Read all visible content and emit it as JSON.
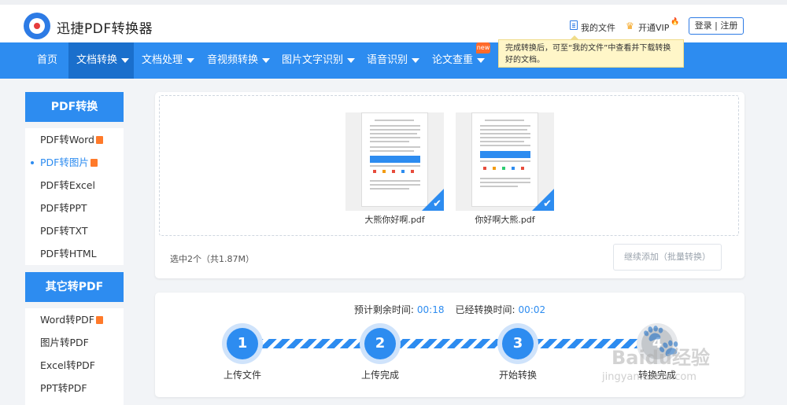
{
  "header": {
    "brand": "迅捷PDF转换器",
    "my_files": "我的文件",
    "vip": "开通VIP",
    "login": "登录 | 注册"
  },
  "nav": {
    "items": [
      {
        "label": "首页",
        "dropdown": false
      },
      {
        "label": "文档转换",
        "dropdown": true,
        "active": true
      },
      {
        "label": "文档处理",
        "dropdown": true
      },
      {
        "label": "音视频转换",
        "dropdown": true
      },
      {
        "label": "图片文字识别",
        "dropdown": true
      },
      {
        "label": "语音识别",
        "dropdown": true
      },
      {
        "label": "论文查重",
        "dropdown": true
      }
    ],
    "new_badge": "new"
  },
  "tooltip": {
    "text": "完成转换后，可至“我的文件”中查看并下载转换好的文档。"
  },
  "sidebar": {
    "section1": {
      "title": "PDF转换",
      "items": [
        "PDF转Word",
        "PDF转图片",
        "PDF转Excel",
        "PDF转PPT",
        "PDF转TXT",
        "PDF转HTML"
      ]
    },
    "section2": {
      "title": "其它转PDF",
      "items": [
        "Word转PDF",
        "图片转PDF",
        "Excel转PDF",
        "PPT转PDF"
      ]
    }
  },
  "upload": {
    "files": [
      {
        "name": "大熊你好啊.pdf"
      },
      {
        "name": "你好啊大熊.pdf"
      }
    ],
    "selection_info": "选中2个（共1.87M）",
    "add_button": "继续添加（批量转换）"
  },
  "progress": {
    "remaining_label": "预计剩余时间:",
    "remaining_value": "00:18",
    "elapsed_label": "已经转换时间:",
    "elapsed_value": "00:02",
    "steps": [
      {
        "num": "1",
        "label": "上传文件",
        "done": true
      },
      {
        "num": "2",
        "label": "上传完成",
        "done": true
      },
      {
        "num": "3",
        "label": "开始转换",
        "done": true
      },
      {
        "num": "4",
        "label": "转换完成",
        "done": false
      }
    ]
  },
  "watermark": {
    "text": "Baidu经验",
    "url": "jingyan.baidu.com"
  },
  "colors": {
    "accent": "#2d8cf0",
    "nav_active": "#1a6fcc",
    "tooltip_bg": "#fff6c8",
    "badge": "#ff6a2a"
  }
}
